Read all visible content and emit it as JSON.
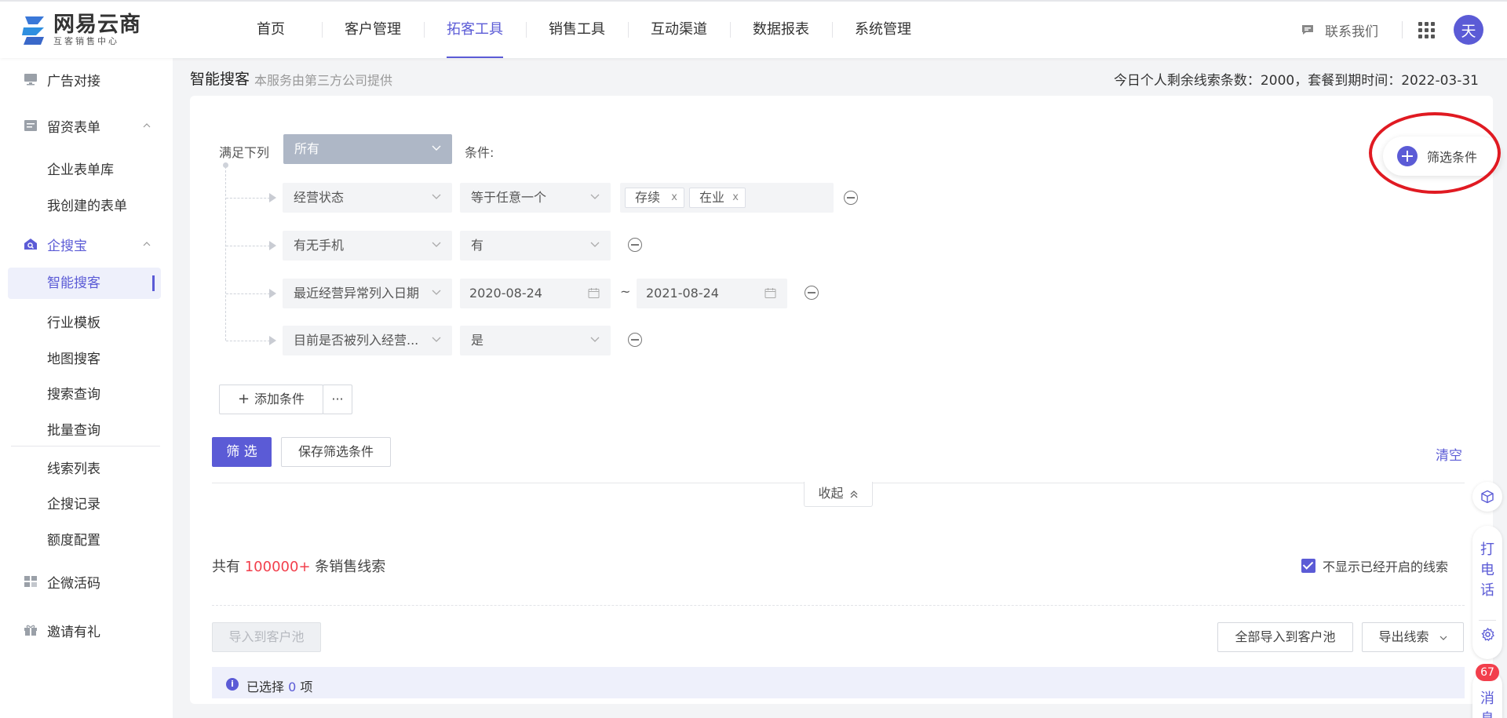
{
  "brand": {
    "name": "网易云商",
    "tagline": "互客销售中心",
    "color": "#5b5bd6"
  },
  "nav": {
    "items": [
      "首页",
      "客户管理",
      "拓客工具",
      "销售工具",
      "互动渠道",
      "数据报表",
      "系统管理"
    ],
    "active": "拓客工具"
  },
  "header_right": {
    "contact": "联系我们",
    "avatar_initial": "天"
  },
  "sidebar": {
    "groups": [
      {
        "label": "广告对接",
        "icon": "monitor-icon"
      },
      {
        "label": "留资表单",
        "icon": "form-icon",
        "expanded": true,
        "children": [
          "企业表单库",
          "我创建的表单"
        ]
      },
      {
        "label": "企搜宝",
        "icon": "search-home-icon",
        "expanded": true,
        "children": [
          "智能搜客",
          "行业模板",
          "地图搜客",
          "搜索查询",
          "批量查询",
          "线索列表",
          "企搜记录",
          "额度配置"
        ]
      },
      {
        "label": "企微活码",
        "icon": "grid-blocks-icon"
      },
      {
        "label": "邀请有礼",
        "icon": "gift-icon"
      }
    ],
    "active_item": "智能搜客"
  },
  "page": {
    "title": "智能搜客",
    "subtitle": "本服务由第三方公司提供",
    "quota": "今日个人剩余线索条数：2000，套餐到期时间：2022-03-31"
  },
  "filter": {
    "match_label": "满足下列",
    "match_value": "所有",
    "condition_label": "条件:",
    "rows": [
      {
        "field": "经营状态",
        "operator": "等于任意一个",
        "tags": [
          "存续",
          "在业"
        ]
      },
      {
        "field": "有无手机",
        "operator": "有"
      },
      {
        "field": "最近经营异常列入日期",
        "date_from": "2020-08-24",
        "date_sep": "~",
        "date_to": "2021-08-24"
      },
      {
        "field": "目前是否被列入经营...",
        "operator": "是"
      }
    ],
    "add_condition": "添加条件",
    "more": "···",
    "filter_btn": "筛 选",
    "save_btn": "保存筛选条件",
    "clear": "清空",
    "collapse": "收起",
    "floating_add": "筛选条件"
  },
  "results": {
    "prefix": "共有",
    "count": "100000+",
    "suffix": "条销售线索",
    "hide_opened": "不显示已经开启的线索",
    "hide_opened_checked": true,
    "import_btn": "导入到客户池",
    "import_all_btn": "全部导入到客户池",
    "export_btn": "导出线索",
    "selected_prefix": "已选择",
    "selected_count": "0",
    "selected_suffix": "项"
  },
  "float_bar": {
    "call": "打\n电\n话",
    "messages": "消\n息",
    "badge": "67"
  },
  "colors": {
    "accent": "#5b5bd6",
    "highlight": "#e01a22",
    "count_red": "#f23f4c"
  }
}
